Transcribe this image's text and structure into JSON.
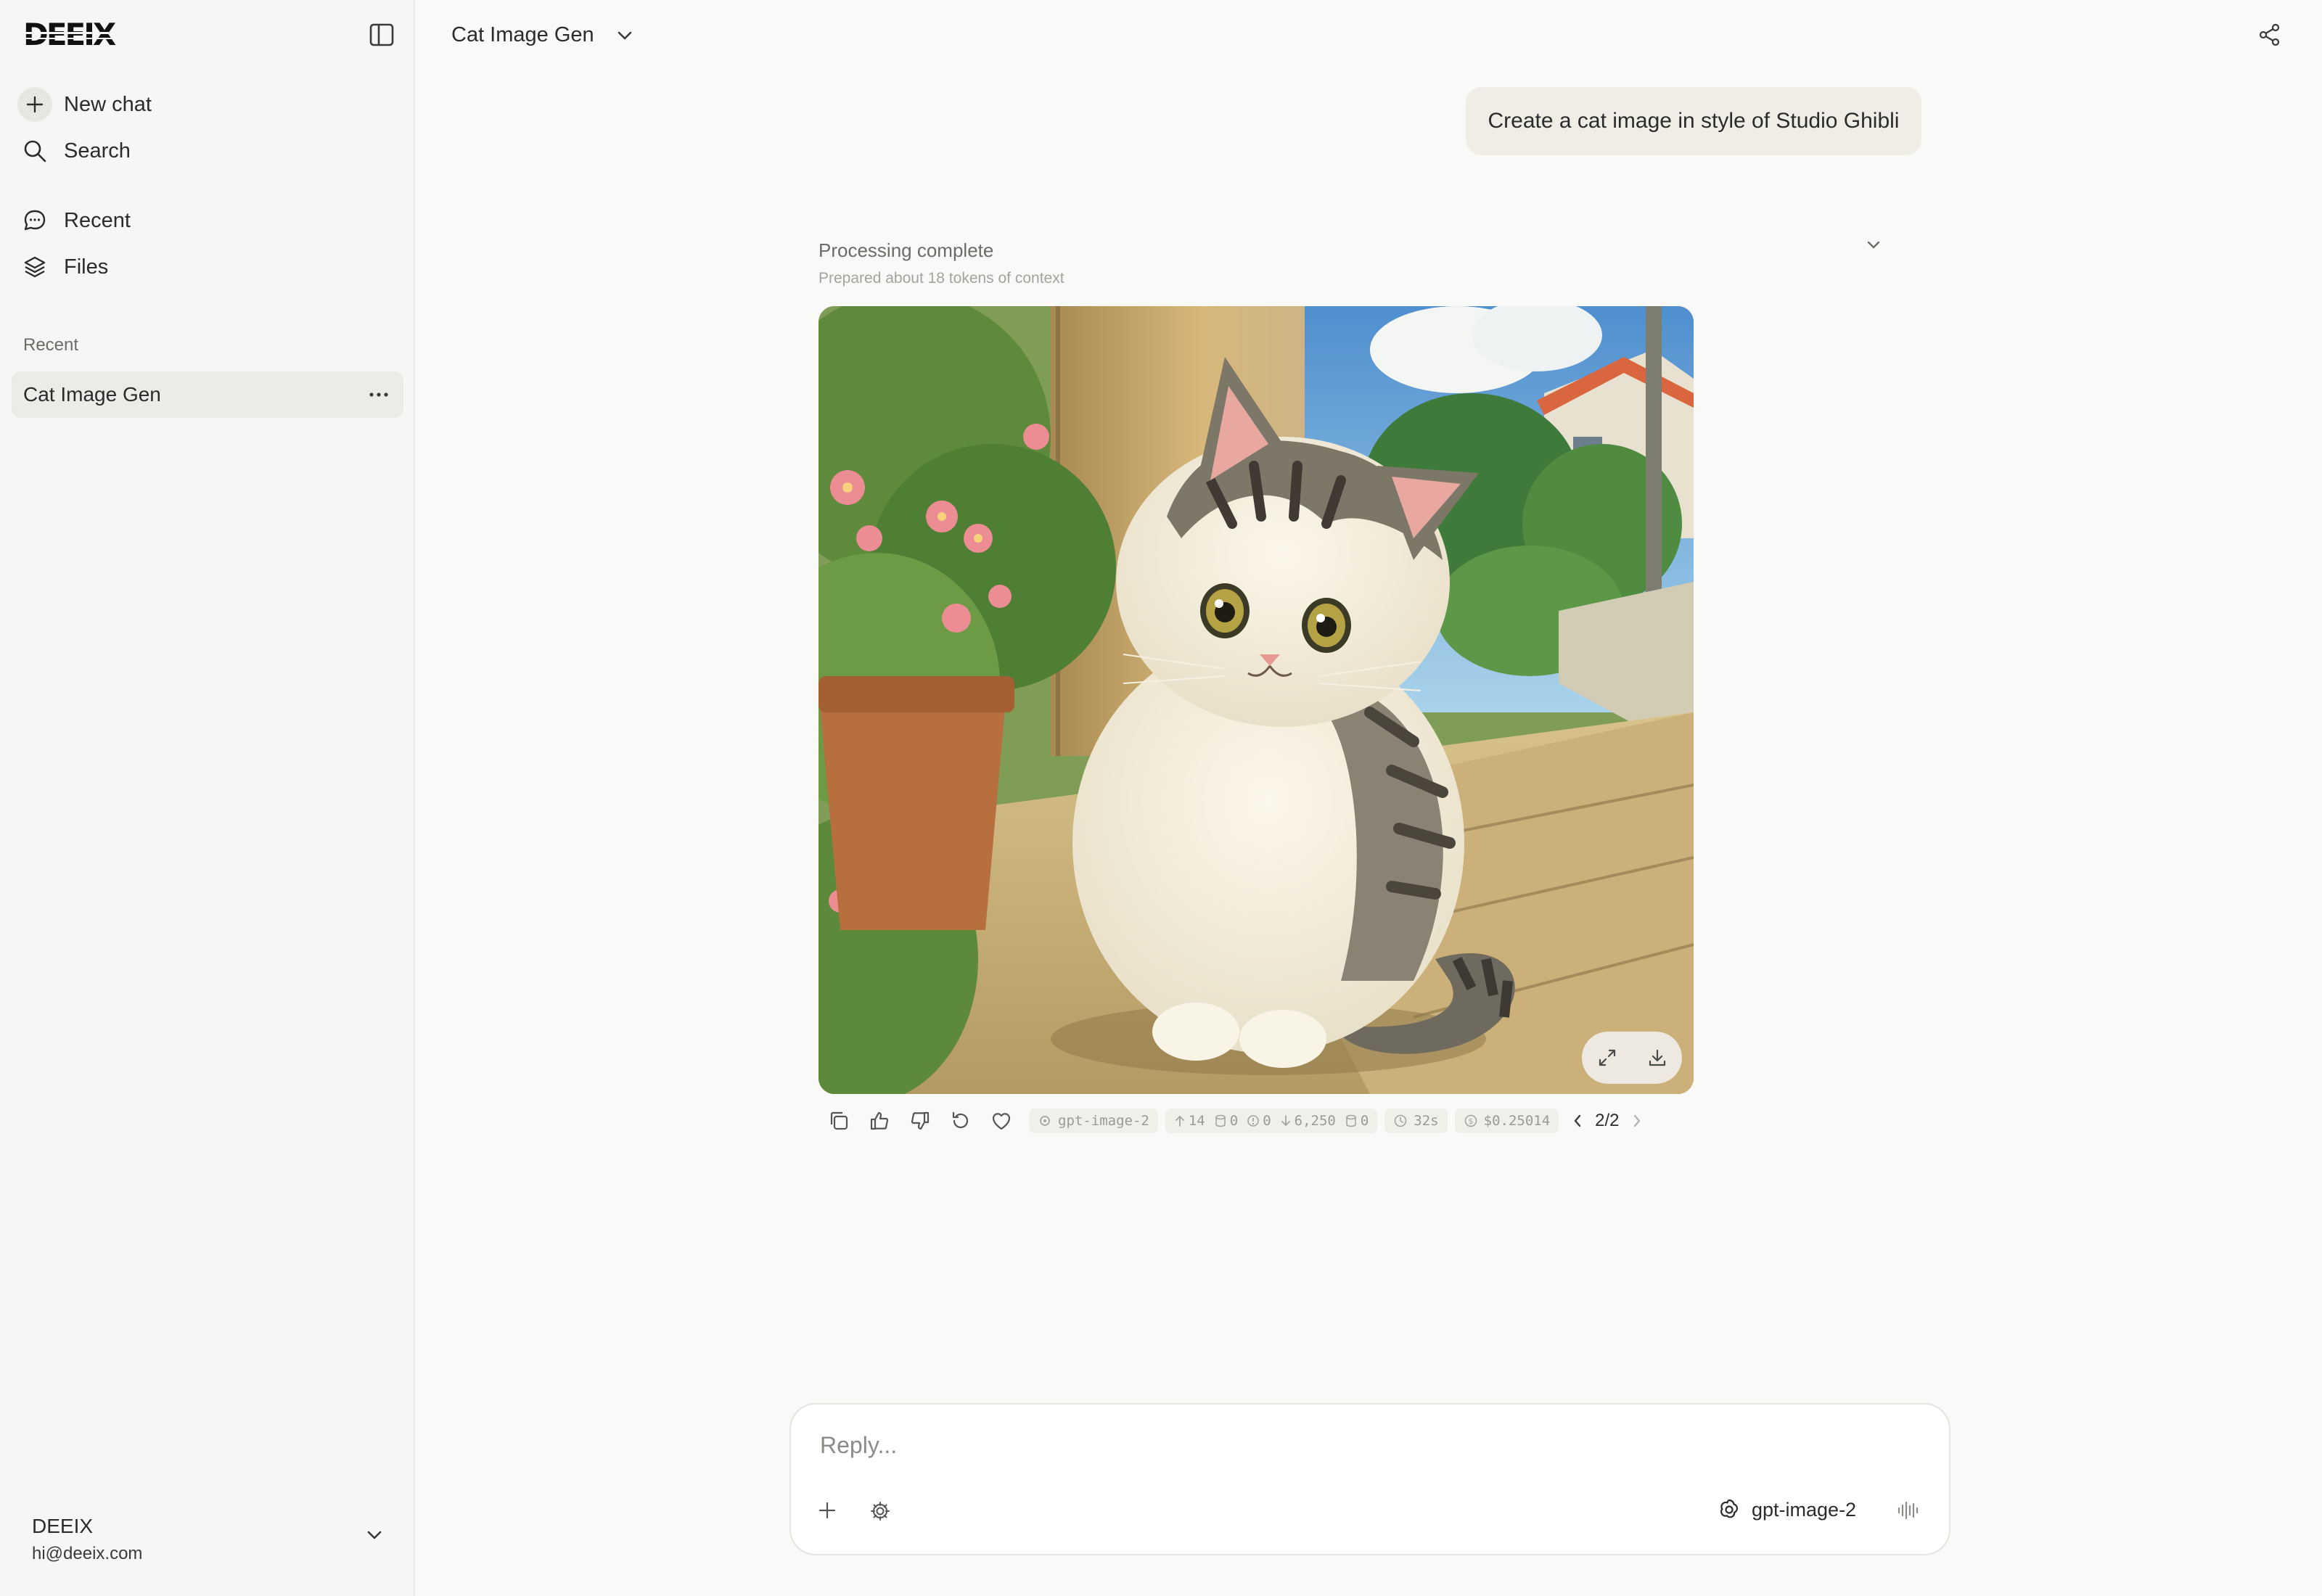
{
  "sidebar": {
    "brand": "DEEIX",
    "nav": {
      "new_chat": "New chat",
      "search": "Search",
      "recent": "Recent",
      "files": "Files"
    },
    "section_label": "Recent",
    "recent_items": [
      {
        "label": "Cat Image Gen"
      }
    ],
    "user": {
      "name": "DEEIX",
      "email": "hi@deeix.com"
    }
  },
  "header": {
    "title": "Cat Image Gen"
  },
  "conversation": {
    "user_message": "Create a cat image in style of Studio Ghibli",
    "assistant": {
      "status_title": "Processing complete",
      "status_subtitle": "Prepared about 18 tokens of context",
      "meta": {
        "model": "gpt-image-2",
        "input_tokens": "14",
        "cached_tokens": "0",
        "reasoning_tokens": "0",
        "output_tokens": "6,250",
        "output_cached": "0",
        "duration": "32s",
        "cost": "$0.25014",
        "page": "2/2"
      }
    }
  },
  "composer": {
    "placeholder": "Reply...",
    "model_label": "gpt-image-2"
  },
  "colors": {
    "background": "#f9f9f7",
    "sidebar": "#f6f6f4",
    "user_bubble": "#efede6",
    "selected_item": "#ebebe7"
  }
}
